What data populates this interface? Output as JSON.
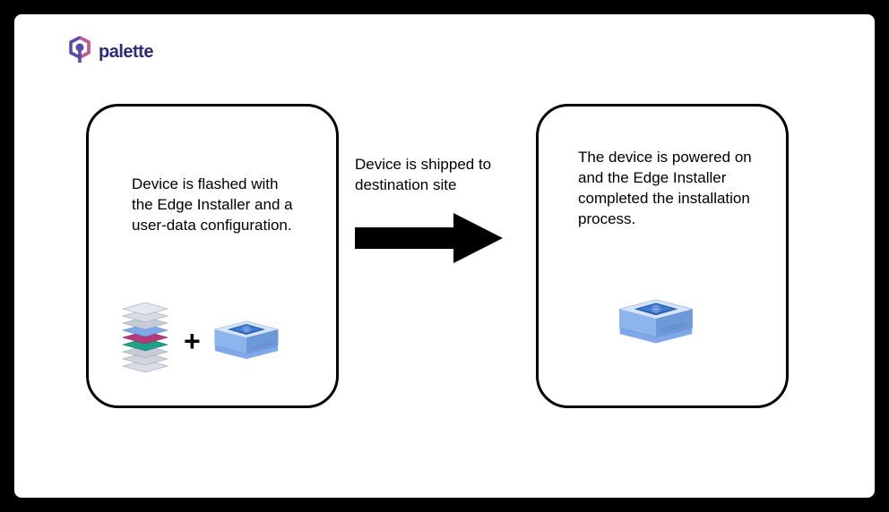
{
  "logo": {
    "text": "palette"
  },
  "left_box": {
    "text": "Device is flashed with the Edge Installer and a user-data configuration."
  },
  "arrow": {
    "label": "Device is shipped to destination site"
  },
  "right_box": {
    "text": "The device is powered on and the Edge Installer completed the installation process."
  },
  "plus_symbol": "+"
}
